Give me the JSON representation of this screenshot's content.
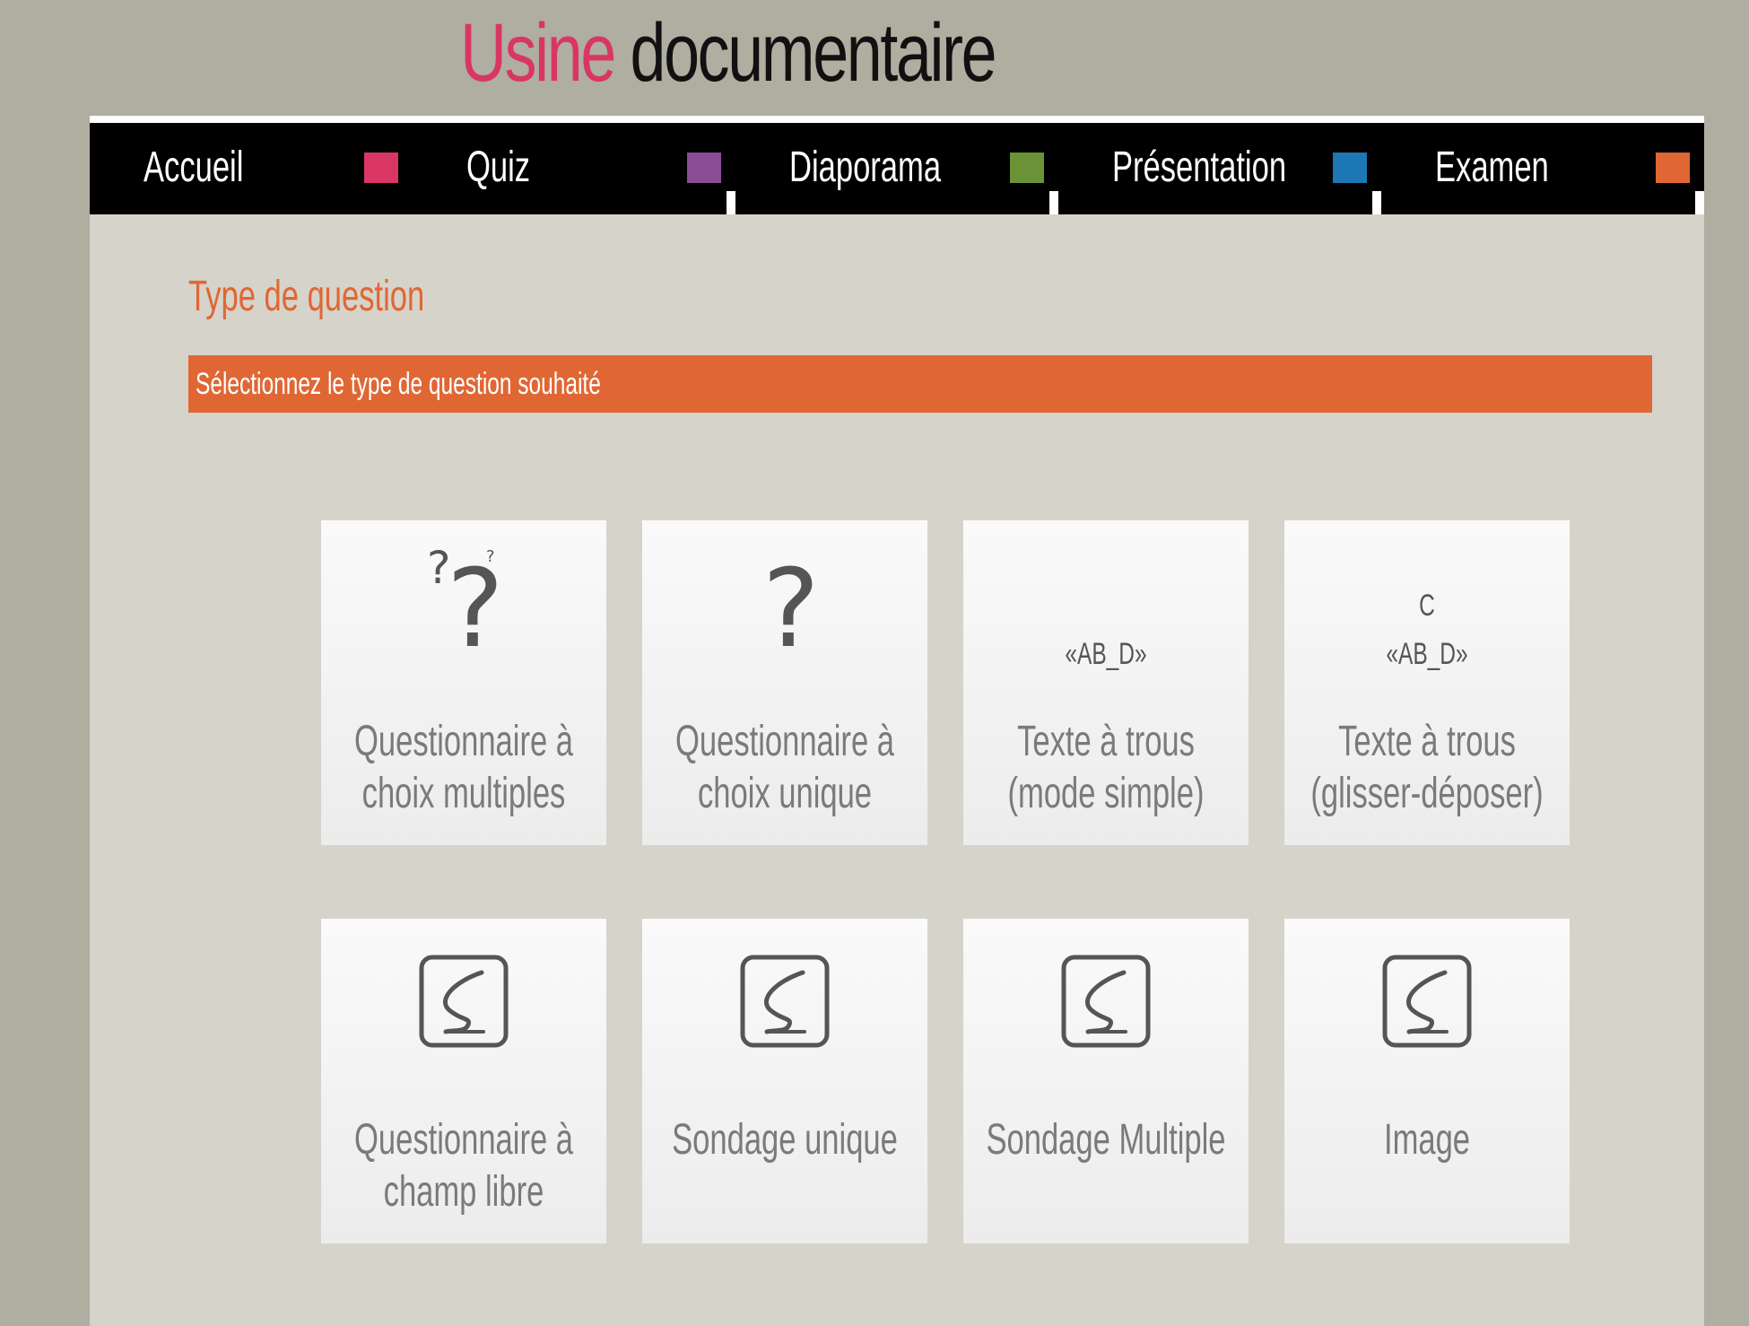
{
  "site": {
    "title_accent": "Usine",
    "title_rest": " documentaire"
  },
  "nav": {
    "items": [
      {
        "label": "Accueil",
        "color": "#d93664"
      },
      {
        "label": "Quiz",
        "color": "#8b4c96"
      },
      {
        "label": "Diaporama",
        "color": "#6a9236"
      },
      {
        "label": "Présentation",
        "color": "#1d77b5"
      },
      {
        "label": "Examen",
        "color": "#e06733"
      }
    ]
  },
  "page": {
    "section_title": "Type de question",
    "banner": "Sélectionnez le type de question souhaité"
  },
  "cards": [
    {
      "label": "Questionnaire à choix multiples",
      "icon": "multiple-question-marks-icon"
    },
    {
      "label": "Questionnaire à choix unique",
      "icon": "question-mark-icon"
    },
    {
      "label": "Texte à trous (mode simple)",
      "icon": "gap-text-icon",
      "icon_text": "«AB_D»"
    },
    {
      "label": "Texte à trous (glisser-déposer)",
      "icon": "drag-gap-text-icon",
      "icon_letter": "C",
      "icon_text": "«AB_D»"
    },
    {
      "label": "Questionnaire à champ libre",
      "icon": "squiggle-box-icon"
    },
    {
      "label": "Sondage unique",
      "icon": "squiggle-box-icon"
    },
    {
      "label": "Sondage Multiple",
      "icon": "squiggle-box-icon"
    },
    {
      "label": "Image",
      "icon": "squiggle-box-icon"
    }
  ],
  "colors": {
    "accent": "#e06733",
    "title_accent": "#d93664",
    "page_background": "#b0ada1",
    "content_background": "#d6d3cb"
  }
}
